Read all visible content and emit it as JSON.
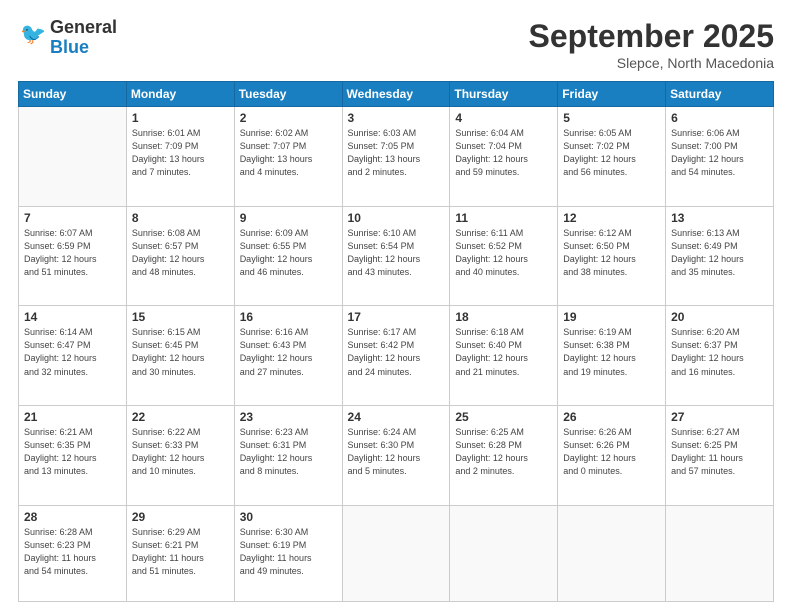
{
  "header": {
    "logo_line1": "General",
    "logo_line2": "Blue",
    "month": "September 2025",
    "location": "Slepce, North Macedonia"
  },
  "days_of_week": [
    "Sunday",
    "Monday",
    "Tuesday",
    "Wednesday",
    "Thursday",
    "Friday",
    "Saturday"
  ],
  "weeks": [
    [
      {
        "day": "",
        "info": ""
      },
      {
        "day": "1",
        "info": "Sunrise: 6:01 AM\nSunset: 7:09 PM\nDaylight: 13 hours\nand 7 minutes."
      },
      {
        "day": "2",
        "info": "Sunrise: 6:02 AM\nSunset: 7:07 PM\nDaylight: 13 hours\nand 4 minutes."
      },
      {
        "day": "3",
        "info": "Sunrise: 6:03 AM\nSunset: 7:05 PM\nDaylight: 13 hours\nand 2 minutes."
      },
      {
        "day": "4",
        "info": "Sunrise: 6:04 AM\nSunset: 7:04 PM\nDaylight: 12 hours\nand 59 minutes."
      },
      {
        "day": "5",
        "info": "Sunrise: 6:05 AM\nSunset: 7:02 PM\nDaylight: 12 hours\nand 56 minutes."
      },
      {
        "day": "6",
        "info": "Sunrise: 6:06 AM\nSunset: 7:00 PM\nDaylight: 12 hours\nand 54 minutes."
      }
    ],
    [
      {
        "day": "7",
        "info": "Sunrise: 6:07 AM\nSunset: 6:59 PM\nDaylight: 12 hours\nand 51 minutes."
      },
      {
        "day": "8",
        "info": "Sunrise: 6:08 AM\nSunset: 6:57 PM\nDaylight: 12 hours\nand 48 minutes."
      },
      {
        "day": "9",
        "info": "Sunrise: 6:09 AM\nSunset: 6:55 PM\nDaylight: 12 hours\nand 46 minutes."
      },
      {
        "day": "10",
        "info": "Sunrise: 6:10 AM\nSunset: 6:54 PM\nDaylight: 12 hours\nand 43 minutes."
      },
      {
        "day": "11",
        "info": "Sunrise: 6:11 AM\nSunset: 6:52 PM\nDaylight: 12 hours\nand 40 minutes."
      },
      {
        "day": "12",
        "info": "Sunrise: 6:12 AM\nSunset: 6:50 PM\nDaylight: 12 hours\nand 38 minutes."
      },
      {
        "day": "13",
        "info": "Sunrise: 6:13 AM\nSunset: 6:49 PM\nDaylight: 12 hours\nand 35 minutes."
      }
    ],
    [
      {
        "day": "14",
        "info": "Sunrise: 6:14 AM\nSunset: 6:47 PM\nDaylight: 12 hours\nand 32 minutes."
      },
      {
        "day": "15",
        "info": "Sunrise: 6:15 AM\nSunset: 6:45 PM\nDaylight: 12 hours\nand 30 minutes."
      },
      {
        "day": "16",
        "info": "Sunrise: 6:16 AM\nSunset: 6:43 PM\nDaylight: 12 hours\nand 27 minutes."
      },
      {
        "day": "17",
        "info": "Sunrise: 6:17 AM\nSunset: 6:42 PM\nDaylight: 12 hours\nand 24 minutes."
      },
      {
        "day": "18",
        "info": "Sunrise: 6:18 AM\nSunset: 6:40 PM\nDaylight: 12 hours\nand 21 minutes."
      },
      {
        "day": "19",
        "info": "Sunrise: 6:19 AM\nSunset: 6:38 PM\nDaylight: 12 hours\nand 19 minutes."
      },
      {
        "day": "20",
        "info": "Sunrise: 6:20 AM\nSunset: 6:37 PM\nDaylight: 12 hours\nand 16 minutes."
      }
    ],
    [
      {
        "day": "21",
        "info": "Sunrise: 6:21 AM\nSunset: 6:35 PM\nDaylight: 12 hours\nand 13 minutes."
      },
      {
        "day": "22",
        "info": "Sunrise: 6:22 AM\nSunset: 6:33 PM\nDaylight: 12 hours\nand 10 minutes."
      },
      {
        "day": "23",
        "info": "Sunrise: 6:23 AM\nSunset: 6:31 PM\nDaylight: 12 hours\nand 8 minutes."
      },
      {
        "day": "24",
        "info": "Sunrise: 6:24 AM\nSunset: 6:30 PM\nDaylight: 12 hours\nand 5 minutes."
      },
      {
        "day": "25",
        "info": "Sunrise: 6:25 AM\nSunset: 6:28 PM\nDaylight: 12 hours\nand 2 minutes."
      },
      {
        "day": "26",
        "info": "Sunrise: 6:26 AM\nSunset: 6:26 PM\nDaylight: 12 hours\nand 0 minutes."
      },
      {
        "day": "27",
        "info": "Sunrise: 6:27 AM\nSunset: 6:25 PM\nDaylight: 11 hours\nand 57 minutes."
      }
    ],
    [
      {
        "day": "28",
        "info": "Sunrise: 6:28 AM\nSunset: 6:23 PM\nDaylight: 11 hours\nand 54 minutes."
      },
      {
        "day": "29",
        "info": "Sunrise: 6:29 AM\nSunset: 6:21 PM\nDaylight: 11 hours\nand 51 minutes."
      },
      {
        "day": "30",
        "info": "Sunrise: 6:30 AM\nSunset: 6:19 PM\nDaylight: 11 hours\nand 49 minutes."
      },
      {
        "day": "",
        "info": ""
      },
      {
        "day": "",
        "info": ""
      },
      {
        "day": "",
        "info": ""
      },
      {
        "day": "",
        "info": ""
      }
    ]
  ]
}
